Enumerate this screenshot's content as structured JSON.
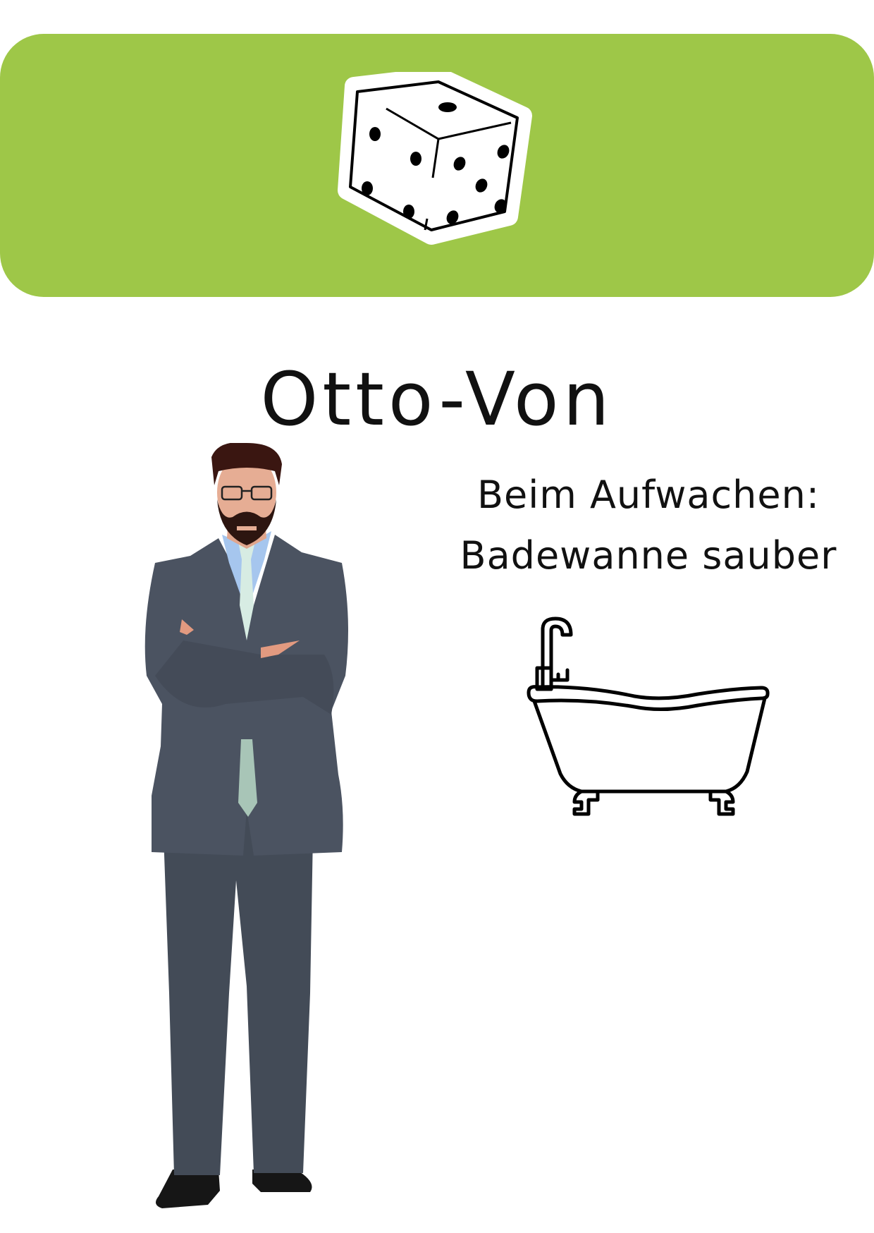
{
  "card": {
    "name": "Otto-Von",
    "condition_line1": "Beim Aufwachen:",
    "condition_line2": "Badewanne sauber"
  },
  "icons": [
    "dice-icon",
    "bathtub-icon",
    "person-illustration"
  ],
  "colors": {
    "banner": "#9ec748",
    "text": "#111111",
    "suit": "#4a5260"
  }
}
